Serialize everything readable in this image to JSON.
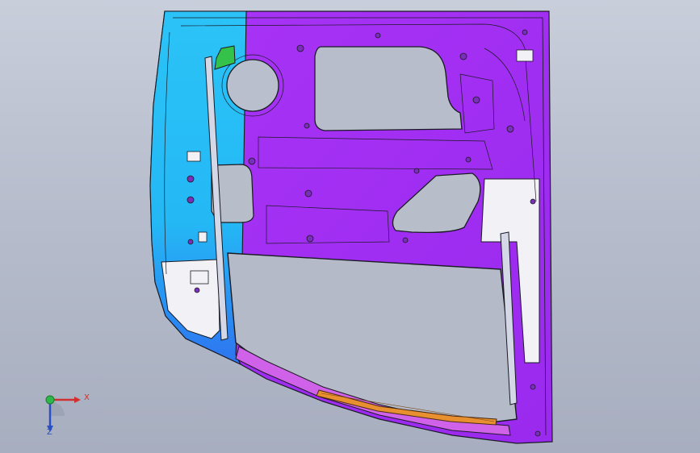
{
  "view": {
    "background_top": "#c9cedb",
    "background_bottom": "#a7aebf"
  },
  "model": {
    "part": "door-inner-panel",
    "colors": {
      "outer_panel_purple": "#a12ff2",
      "front_panel_cyan": "#2bc3f7",
      "front_panel_blue": "#2e74f0",
      "hinge_region_white": "#f1f1f6",
      "lower_strip_magenta": "#d062ea",
      "bracket_green": "#34c24a",
      "reinforcement_orange": "#e88f2f",
      "cutout_grey": "#8f9299",
      "line_dark": "#1b1b24"
    }
  },
  "triad": {
    "x_label": "X",
    "z_label": "Z",
    "icon": "coordinate-triad-icon",
    "x_color": "#d23030",
    "y_color": "#2fb84a",
    "z_color": "#2a4fc4"
  }
}
